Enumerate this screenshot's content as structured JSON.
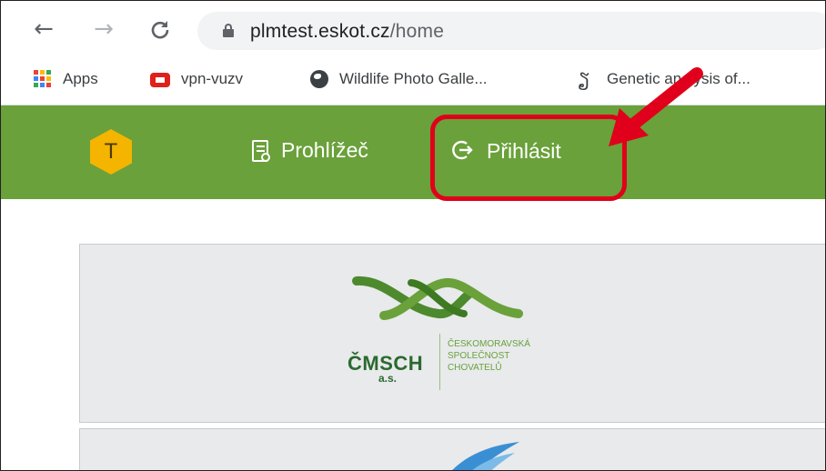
{
  "browser": {
    "url_domain": "plmtest.eskot.cz",
    "url_path": "/home",
    "back_icon": "←",
    "forward_icon": "→",
    "reload_icon": "C"
  },
  "bookmarks": [
    {
      "label": "Apps",
      "icon": "apps-grid-icon"
    },
    {
      "label": "vpn-vuzv",
      "icon": "fortinet-icon"
    },
    {
      "label": "Wildlife Photo Galle...",
      "icon": "globe-icon"
    },
    {
      "label": "Genetic analysis of...",
      "icon": "dna-icon"
    }
  ],
  "app_header": {
    "logo_letter": "T",
    "menu": [
      {
        "label": "Prohlížeč",
        "icon": "document-search-icon"
      },
      {
        "label": "Přihlásit",
        "icon": "login-icon",
        "highlighted": true
      }
    ],
    "accent_color": "#6aa13a",
    "highlight_color": "#e0001b"
  },
  "cards": [
    {
      "brand": "ČMSCH",
      "brand_sub": "a.s.",
      "desc_lines": [
        "ČESKOMORAVSKÁ",
        "SPOLEČNOST",
        "CHOVATELŮ"
      ]
    }
  ]
}
